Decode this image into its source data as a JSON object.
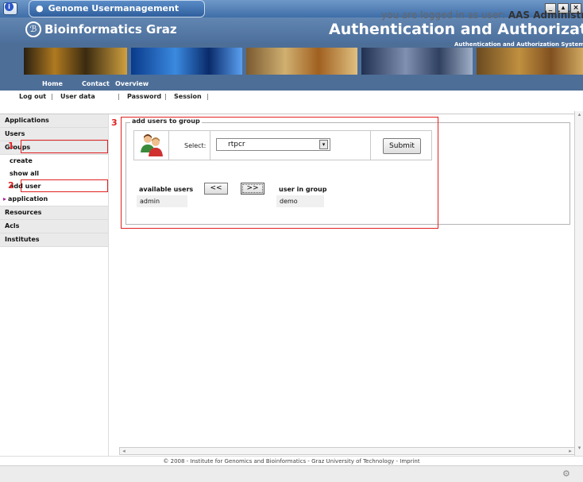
{
  "window": {
    "title": "Genome Usermanagement"
  },
  "banner": {
    "site_title": "Bioinformatics Graz",
    "app_title": "Authentication and Authorization",
    "app_subtitle": "Authentication and Authorization System"
  },
  "topnav": {
    "items": [
      "Home",
      "Contact",
      "Overview"
    ]
  },
  "subnav": {
    "items": [
      "Log out",
      "User data",
      "Password",
      "Session"
    ],
    "separator": "|",
    "login_prefix": "you are logged in as user:",
    "login_user": "AAS Administrator"
  },
  "sidebar": {
    "items": [
      {
        "label": "Applications",
        "type": "main"
      },
      {
        "label": "Users",
        "type": "main"
      },
      {
        "label": "Groups",
        "type": "main"
      },
      {
        "label": "create",
        "type": "sub"
      },
      {
        "label": "show all",
        "type": "sub"
      },
      {
        "label": "add user",
        "type": "sub"
      },
      {
        "label": "application",
        "type": "sub-arrow"
      },
      {
        "label": "Resources",
        "type": "main"
      },
      {
        "label": "Acls",
        "type": "main"
      },
      {
        "label": "Institutes",
        "type": "main"
      }
    ]
  },
  "form": {
    "legend": "add users to group",
    "select_label": "Select:",
    "group_value": "rtpcr",
    "submit_label": "Submit",
    "available_header": "available users",
    "available_users": [
      "admin"
    ],
    "move_left_label": "<<",
    "move_right_label": ">>",
    "in_group_header": "user in group",
    "in_group_users": [
      "demo"
    ]
  },
  "annotations": {
    "labels": [
      "1",
      "2",
      "3"
    ],
    "color": "#e02020"
  },
  "footer": {
    "text": "© 2008 - Institute for Genomics and Bioinformatics - Graz University of Technology - Imprint"
  },
  "colors": {
    "banner": "#4d6e97",
    "titlebar": "#3f6ea8",
    "sidebar_main": "#eaeaea"
  },
  "icons": {
    "window_menu": "chevron-down-icon",
    "tab": "globe-icon",
    "info": "info-icon",
    "users": "users-icon",
    "status": "gear-icon"
  }
}
